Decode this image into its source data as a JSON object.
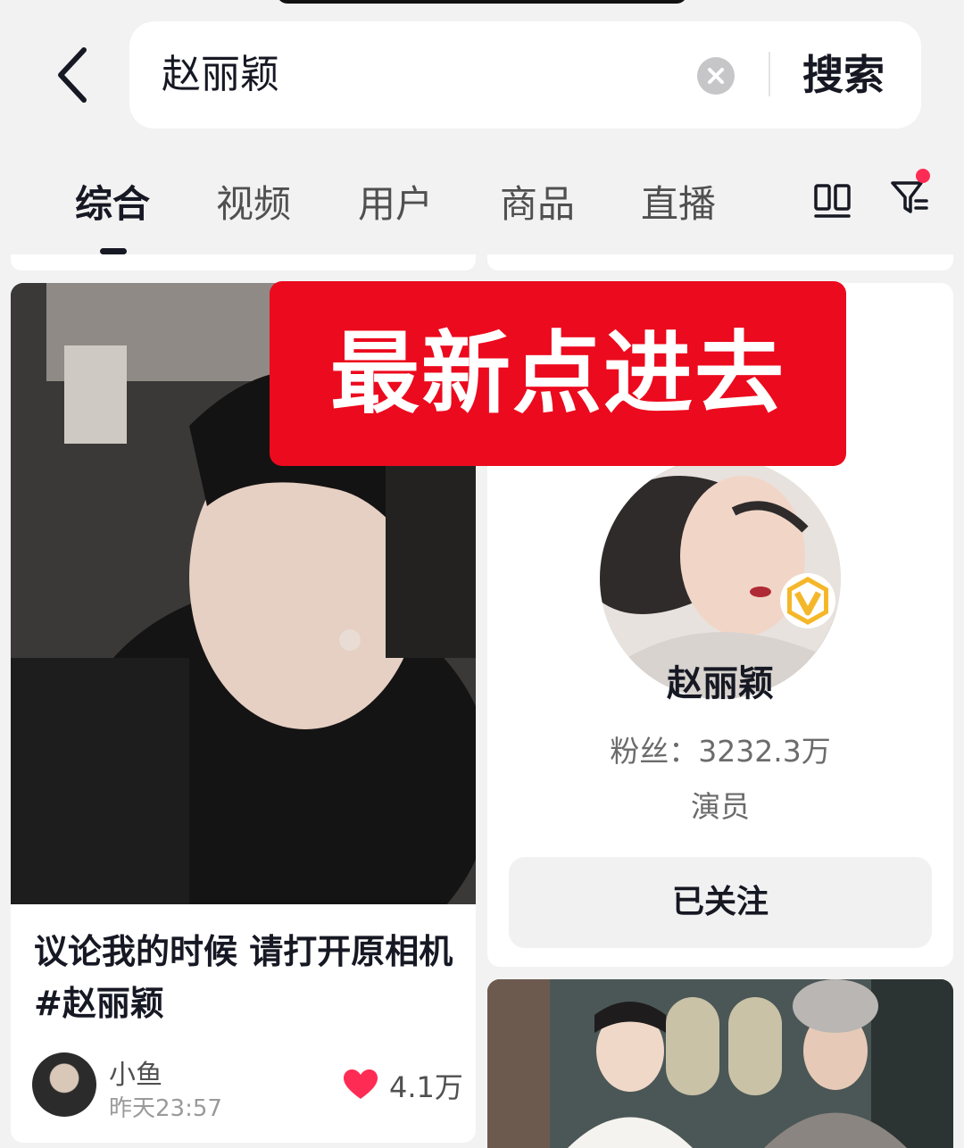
{
  "search": {
    "query": "赵丽颖",
    "submit_label": "搜索"
  },
  "tabs": [
    {
      "label": "综合",
      "active": true
    },
    {
      "label": "视频",
      "active": false
    },
    {
      "label": "用户",
      "active": false
    },
    {
      "label": "商品",
      "active": false
    },
    {
      "label": "直播",
      "active": false
    }
  ],
  "overlay_banner": "最新点进去",
  "video_card": {
    "title": "议论我的时候 请打开原相机 #赵丽颖",
    "author": "小鱼",
    "time": "昨天23:57",
    "likes": "4.1万"
  },
  "user_card": {
    "name": "赵丽颖",
    "fans": "粉丝：3232.3万",
    "role": "演员",
    "follow_label": "已关注",
    "verified": true
  },
  "icons": {
    "back": "back-arrow-icon",
    "clear": "clear-icon",
    "grid": "grid-view-icon",
    "filter": "filter-icon",
    "like": "heart-icon",
    "verified": "verified-v-icon"
  },
  "colors": {
    "banner_bg": "#ec0a1e",
    "heart": "#fe2c55",
    "filter_dot": "#fe2c55",
    "verified_gold": "#f5b72a"
  }
}
